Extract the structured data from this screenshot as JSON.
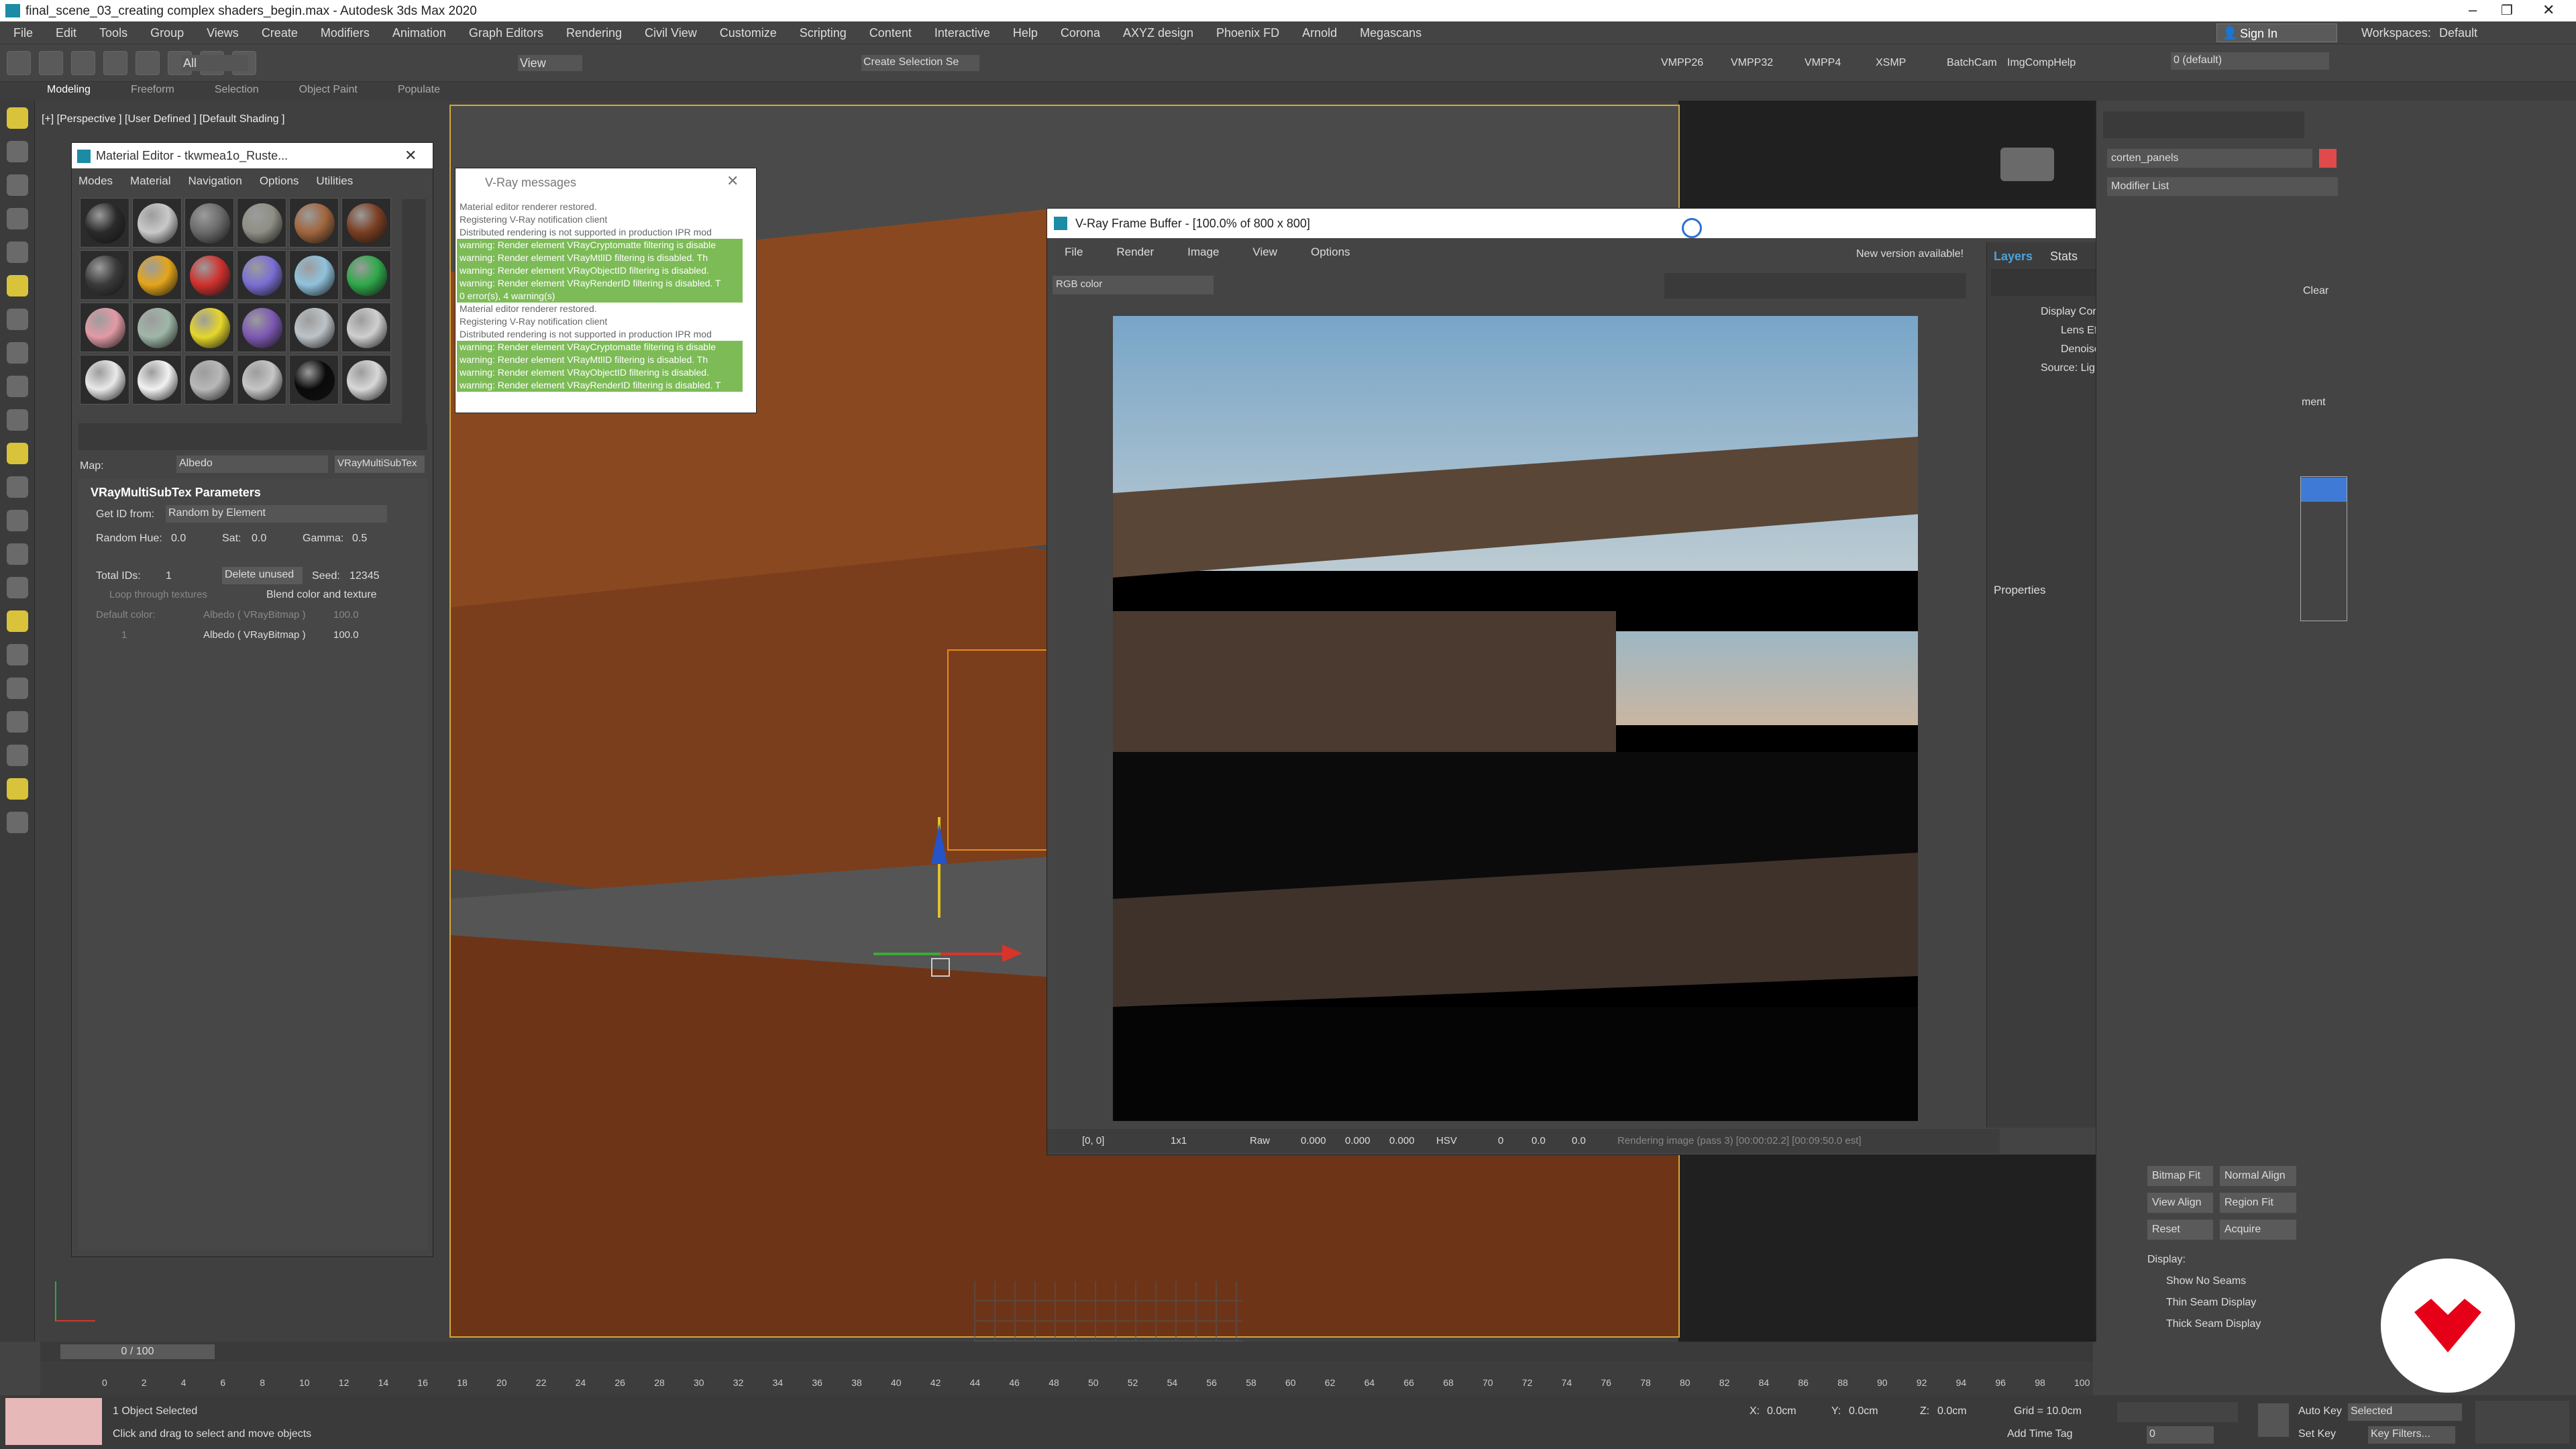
{
  "app": {
    "title": "final_scene_03_creating complex shaders_begin.max - Autodesk 3ds Max 2020"
  },
  "menu": [
    "File",
    "Edit",
    "Tools",
    "Group",
    "Views",
    "Create",
    "Modifiers",
    "Animation",
    "Graph Editors",
    "Rendering",
    "Civil View",
    "Customize",
    "Scripting",
    "Content",
    "Interactive",
    "Help",
    "Corona",
    "AXYZ design",
    "Phoenix FD",
    "Arnold",
    "Megascans"
  ],
  "signin": "Sign In",
  "workspaces_label": "Workspaces:",
  "workspaces_value": "Default",
  "toolbar": {
    "filter": "All",
    "view": "View",
    "selection_set": "Create Selection Se",
    "vmpp26": "VMPP26",
    "vmpp32": "VMPP32",
    "vmpp4": "VMPP4",
    "xsmp": "XSMP",
    "batchcam": "BatchCam",
    "imgcomphelp": "ImgCompHelp",
    "layer": "0 (default)"
  },
  "ribbon_tabs": [
    "Modeling",
    "Freeform",
    "Selection",
    "Object Paint",
    "Populate"
  ],
  "viewport_label": "[+] [Perspective ] [User Defined ] [Default Shading ]",
  "mat_editor": {
    "title": "Material Editor - tkwmea1o_Ruste...",
    "menu": [
      "Modes",
      "Material",
      "Navigation",
      "Options",
      "Utilities"
    ],
    "spheres": [
      "#2a2a2a",
      "#c9c9c9",
      "#6a6a6a",
      "#8f8f85",
      "#a0653d",
      "#7a3e22",
      "#3a3a3a",
      "#e5a51a",
      "#d0312d",
      "#7b6fd4",
      "#90c2dc",
      "#2ea84a",
      "#e29aa6",
      "#9fb7a7",
      "#e6d72a",
      "#7d58b3",
      "#bcc3c8",
      "#cfcfcf",
      "#e9e9e9",
      "#f2f2f2",
      "#b8b8b8",
      "#c6c6c6",
      "#0a0a0a",
      "#d8d8d8"
    ],
    "map_label": "Map:",
    "map_value": "Albedo",
    "map_type": "VRayMultiSubTex",
    "rollout": "VRayMultiSubTex Parameters",
    "getid_label": "Get ID from:",
    "getid_value": "Random by Element",
    "hue_label": "Random Hue:",
    "hue": "0.0",
    "sat_label": "Sat:",
    "sat": "0.0",
    "gamma_label": "Gamma:",
    "gamma": "0.5",
    "totalids_label": "Total IDs:",
    "totalids": "1",
    "delete_unused": "Delete unused",
    "seed_label": "Seed:",
    "seed": "12345",
    "loop": "Loop through textures",
    "blend": "Blend color and texture",
    "default_color": "Default color:",
    "row0_name": "Albedo ( VRayBitmap )",
    "row0_val": "100.0",
    "row1_id": "1",
    "row1_name": "Albedo ( VRayBitmap )",
    "row1_val": "100.0"
  },
  "vray_messages": {
    "title": "V-Ray messages",
    "lines": [
      {
        "text": "Material editor renderer restored.",
        "warn": false
      },
      {
        "text": "Registering V-Ray notification client",
        "warn": false
      },
      {
        "text": "Distributed rendering is not supported in production IPR mod",
        "warn": false
      },
      {
        "text": "warning: Render element VRayCryptomatte filtering is disable",
        "warn": true
      },
      {
        "text": "warning: Render element VRayMtlID filtering is disabled. Th",
        "warn": true
      },
      {
        "text": "warning: Render element VRayObjectID filtering is disabled.",
        "warn": true
      },
      {
        "text": "warning: Render element VRayRenderID filtering is disabled. T",
        "warn": true
      },
      {
        "text": "0 error(s), 4 warning(s)",
        "warn": true
      },
      {
        "text": "Material editor renderer restored.",
        "warn": false
      },
      {
        "text": "Registering V-Ray notification client",
        "warn": false
      },
      {
        "text": "Distributed rendering is not supported in production IPR mod",
        "warn": false
      },
      {
        "text": "warning: Render element VRayCryptomatte filtering is disable",
        "warn": true
      },
      {
        "text": "warning: Render element VRayMtlID filtering is disabled. Th",
        "warn": true
      },
      {
        "text": "warning: Render element VRayObjectID filtering is disabled.",
        "warn": true
      },
      {
        "text": "warning: Render element VRayRenderID filtering is disabled. T",
        "warn": true
      }
    ]
  },
  "vfb": {
    "title": "V-Ray Frame Buffer - [100.0% of 800 x 800]",
    "menu": [
      "File",
      "Render",
      "Image",
      "View",
      "Options"
    ],
    "new_version": "New version available!",
    "channel": "RGB color",
    "layers_tab": "Layers",
    "stats_tab": "Stats",
    "layers": [
      "Display Correction",
      "Lens Effects",
      "Denoiser",
      "Source: LightMix"
    ],
    "properties": "Properties",
    "status": {
      "coords": "[0, 0]",
      "zoom": "1x1",
      "raw": "Raw",
      "r": "0.000",
      "g": "0.000",
      "b": "0.000",
      "mode": "HSV",
      "h": "0",
      "s": "0.0",
      "v": "0.0",
      "progress": "Rendering image (pass 3) [00:00:02.2] [00:09:50.0 est]"
    }
  },
  "cmd_panel": {
    "object_name": "corten_panels",
    "modifier_list": "Modifier List",
    "side_btns": [
      "Clear",
      "ment"
    ],
    "bitmap_fit": "Bitmap Fit",
    "normal_align": "Normal Align",
    "view_align": "View Align",
    "region_fit": "Region Fit",
    "reset": "Reset",
    "acquire": "Acquire",
    "display": "Display:",
    "show_no_seams": "Show No Seams",
    "thin_seam": "Thin Seam Display",
    "thick_seam": "Thick Seam Display"
  },
  "timeline": {
    "frame": "0 / 100",
    "ticks": [
      "0",
      "2",
      "4",
      "6",
      "8",
      "10",
      "12",
      "14",
      "16",
      "18",
      "20",
      "22",
      "24",
      "26",
      "28",
      "30",
      "32",
      "34",
      "36",
      "38",
      "40",
      "42",
      "44",
      "46",
      "48",
      "50",
      "52",
      "54",
      "56",
      "58",
      "60",
      "62",
      "64",
      "66",
      "68",
      "70",
      "72",
      "74",
      "76",
      "78",
      "80",
      "82",
      "84",
      "86",
      "88",
      "90",
      "92",
      "94",
      "96",
      "98",
      "100"
    ]
  },
  "status": {
    "selected": "1 Object Selected",
    "hint": "Click and drag to select and move objects",
    "x_label": "X:",
    "x": "0.0cm",
    "y_label": "Y:",
    "y": "0.0cm",
    "z_label": "Z:",
    "z": "0.0cm",
    "grid": "Grid = 10.0cm",
    "add_time_tag": "Add Time Tag",
    "auto_key": "Auto Key",
    "selected_dd": "Selected",
    "set_key": "Set Key",
    "key_filters": "Key Filters...",
    "frame_field": "0"
  },
  "colors": {
    "accent": "#0097d5",
    "logo": "#e50018",
    "warn_bg": "#7dbb57"
  }
}
